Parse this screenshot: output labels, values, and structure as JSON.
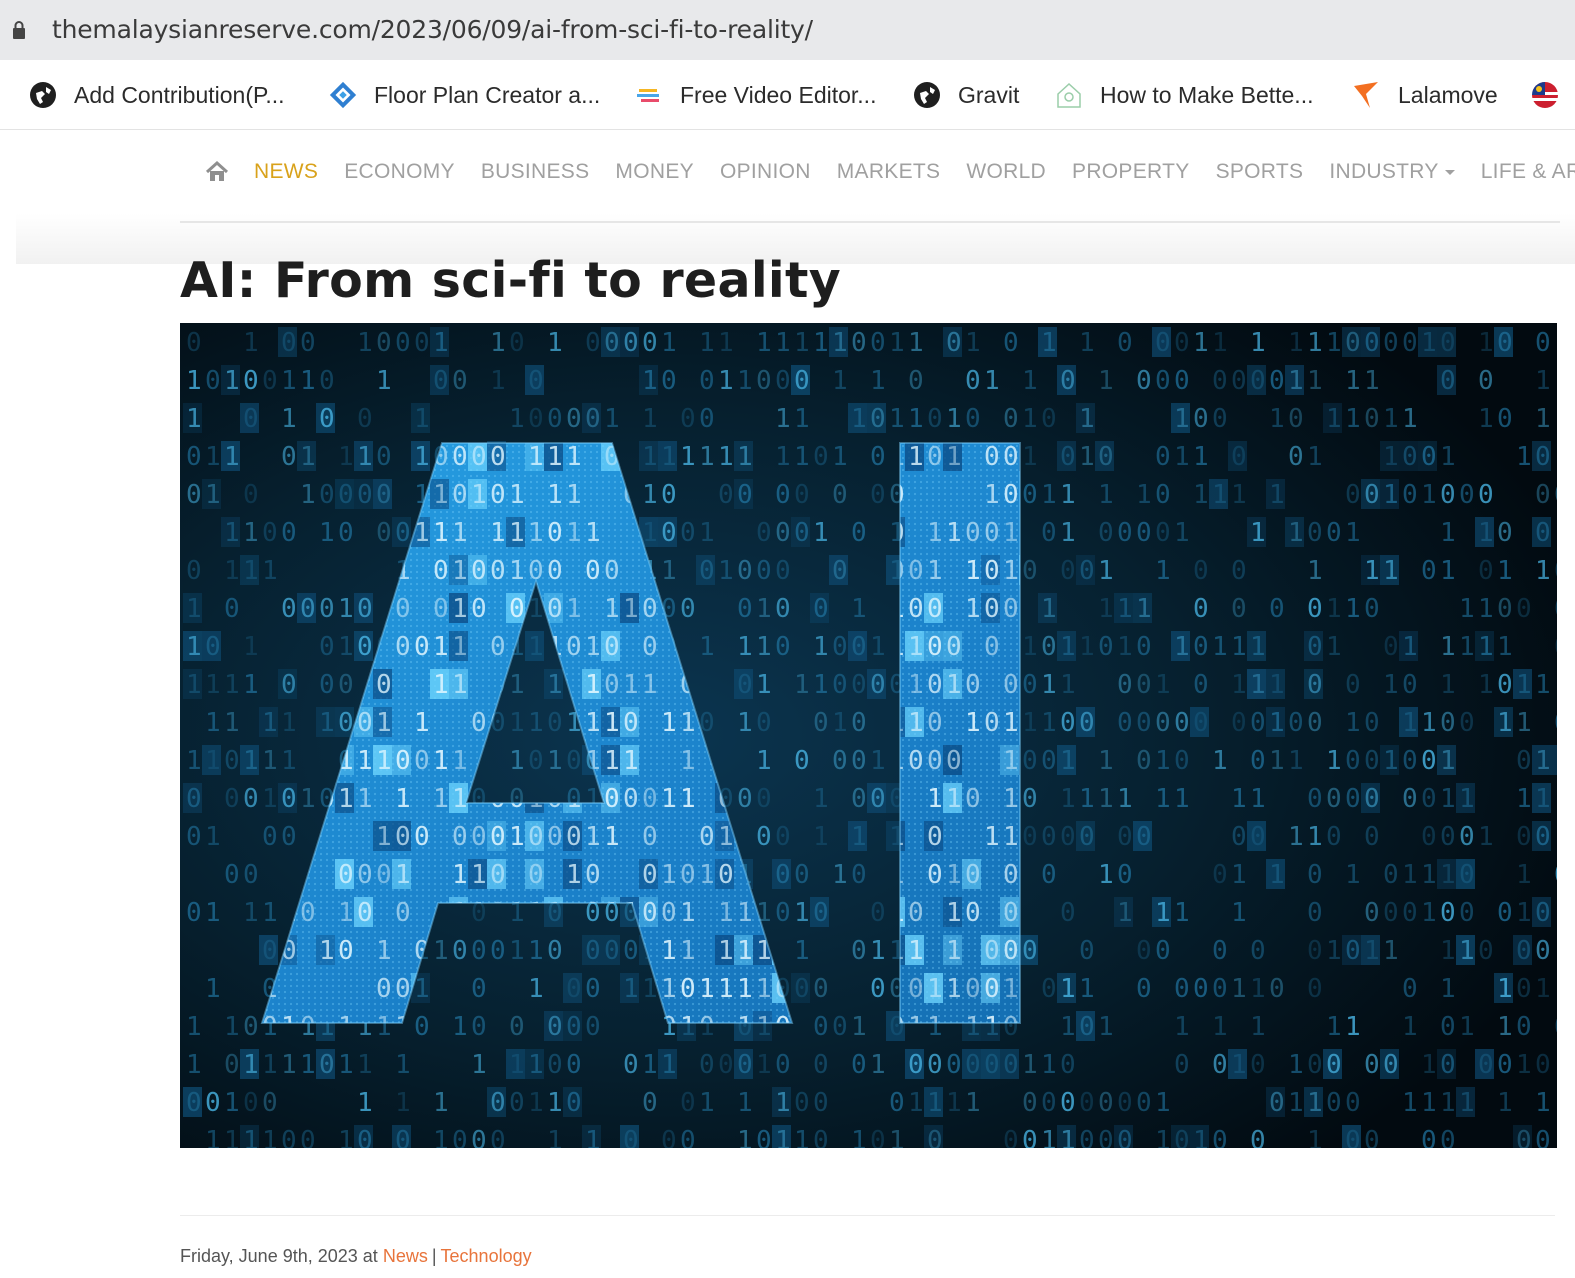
{
  "browser": {
    "url": "themalaysianreserve.com/2023/06/09/ai-from-sci-fi-to-reality/",
    "bookmarks": [
      {
        "label": "Add Contribution(P...",
        "icon": "globe-icon"
      },
      {
        "label": "Floor Plan Creator a...",
        "icon": "floorplan-icon"
      },
      {
        "label": "Free Video Editor...",
        "icon": "video-editor-icon"
      },
      {
        "label": "Gravit",
        "icon": "globe-icon"
      },
      {
        "label": "How to Make Bette...",
        "icon": "house-icon"
      },
      {
        "label": "Lalamove",
        "icon": "lalamove-icon"
      }
    ]
  },
  "nav": {
    "items": [
      "NEWS",
      "ECONOMY",
      "BUSINESS",
      "MONEY",
      "OPINION",
      "MARKETS",
      "WORLD",
      "PROPERTY",
      "SPORTS",
      "INDUSTRY",
      "LIFE & ARTS"
    ],
    "active": "NEWS",
    "active_color": "#d9a21b"
  },
  "article": {
    "title": "AI: From sci-fi to reality",
    "hero_image": "AI-binary-code-image",
    "date": "Friday, June 9th, 2023",
    "at_label": "at",
    "category_news": "News",
    "category_separator": "|",
    "category_tech": "Technology",
    "link_color": "#e8743b"
  }
}
